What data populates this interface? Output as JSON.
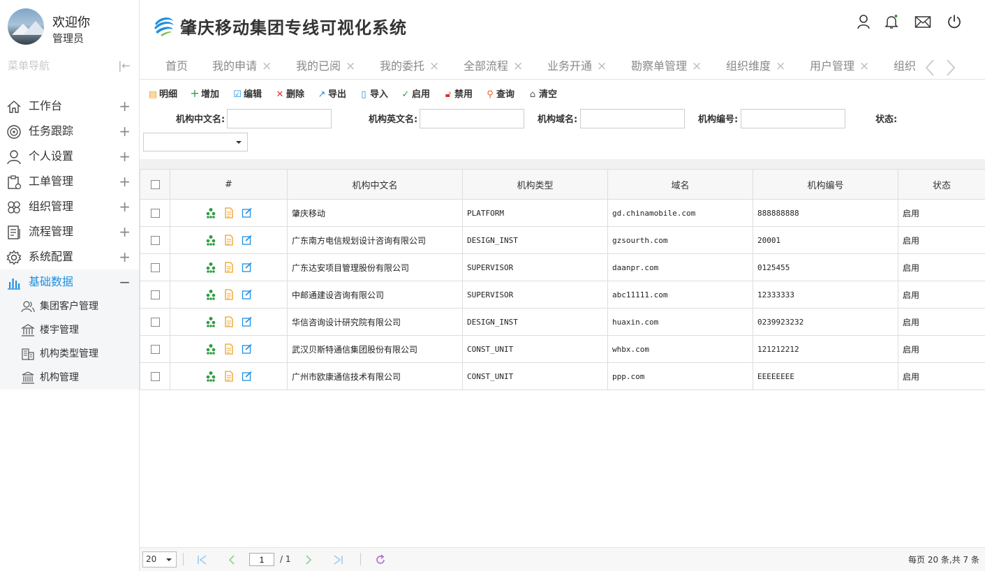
{
  "app": {
    "title": "肇庆移动集团专线可视化系统"
  },
  "user": {
    "welcome": "欢迎你",
    "role": "管理员"
  },
  "sidebar": {
    "title": "菜单导航",
    "items": [
      {
        "label": "工作台",
        "icon": "home-icon",
        "expand": "+"
      },
      {
        "label": "任务跟踪",
        "icon": "target-icon",
        "expand": "+"
      },
      {
        "label": "个人设置",
        "icon": "user-icon",
        "expand": "+"
      },
      {
        "label": "工单管理",
        "icon": "clipboard-icon",
        "expand": "+"
      },
      {
        "label": "组织管理",
        "icon": "org-icon",
        "expand": "+"
      },
      {
        "label": "流程管理",
        "icon": "list-icon",
        "expand": "+"
      },
      {
        "label": "系统配置",
        "icon": "gear-icon",
        "expand": "+"
      },
      {
        "label": "基础数据",
        "icon": "bar-chart-icon",
        "expand": "−"
      }
    ],
    "subitems": [
      {
        "label": "集团客户管理",
        "icon": "users-icon"
      },
      {
        "label": "楼宇管理",
        "icon": "building-icon"
      },
      {
        "label": "机构类型管理",
        "icon": "office-icon"
      },
      {
        "label": "机构管理",
        "icon": "bank-icon"
      }
    ]
  },
  "tabs": [
    {
      "label": "首页",
      "close": ""
    },
    {
      "label": "我的申请",
      "close": "×"
    },
    {
      "label": "我的已阅",
      "close": "×"
    },
    {
      "label": "我的委托",
      "close": "×"
    },
    {
      "label": "全部流程",
      "close": "×"
    },
    {
      "label": "业务开通",
      "close": "×"
    },
    {
      "label": "勘察单管理",
      "close": "×"
    },
    {
      "label": "组织维度",
      "close": "×"
    },
    {
      "label": "用户管理",
      "close": "×"
    },
    {
      "label": "组织",
      "close": ""
    }
  ],
  "toolbar": {
    "detail": "明细",
    "add": "增加",
    "edit": "编辑",
    "delete": "删除",
    "export": "导出",
    "import": "导入",
    "enable": "启用",
    "disable": "禁用",
    "query": "查询",
    "clear": "清空"
  },
  "filters": {
    "cn_name": "机构中文名:",
    "en_name": "机构英文名:",
    "domain": "机构域名:",
    "code": "机构编号:",
    "status": "状态:",
    "cn_name_value": "",
    "en_name_value": "",
    "domain_value": "",
    "code_value": "",
    "status_value": ""
  },
  "table": {
    "headers": [
      "#",
      "机构中文名",
      "机构类型",
      "域名",
      "机构编号",
      "状态"
    ],
    "rows": [
      {
        "name": "肇庆移动",
        "type": "PLATFORM",
        "domain": "gd.chinamobile.com",
        "code": "888888888",
        "status": "启用"
      },
      {
        "name": "广东南方电信规划设计咨询有限公司",
        "type": "DESIGN_INST",
        "domain": "gzsourth.com",
        "code": "20001",
        "status": "启用"
      },
      {
        "name": "广东达安项目管理股份有限公司",
        "type": "SUPERVISOR",
        "domain": "daanpr.com",
        "code": "0125455",
        "status": "启用"
      },
      {
        "name": "中邮通建设咨询有限公司",
        "type": "SUPERVISOR",
        "domain": "abc11111.com",
        "code": "12333333",
        "status": "启用"
      },
      {
        "name": "华信咨询设计研究院有限公司",
        "type": "DESIGN_INST",
        "domain": "huaxin.com",
        "code": "0239923232",
        "status": "启用"
      },
      {
        "name": "武汉贝斯特通信集团股份有限公司",
        "type": "CONST_UNIT",
        "domain": "whbx.com",
        "code": "121212212",
        "status": "启用"
      },
      {
        "name": "广州市欧康通信技术有限公司",
        "type": "CONST_UNIT",
        "domain": "ppp.com",
        "code": "EEEEEEEE",
        "status": "启用"
      }
    ]
  },
  "pager": {
    "page_size": "20",
    "current_page": "1",
    "total_pages": "/ 1",
    "info": "每页 20 条,共 7 条"
  },
  "colors": {
    "accent": "#1e8fe0",
    "green_icon": "#2e9e3e",
    "orange_icon": "#f0a020",
    "blue_icon": "#1e8fe0",
    "red_icon": "#e03030"
  }
}
